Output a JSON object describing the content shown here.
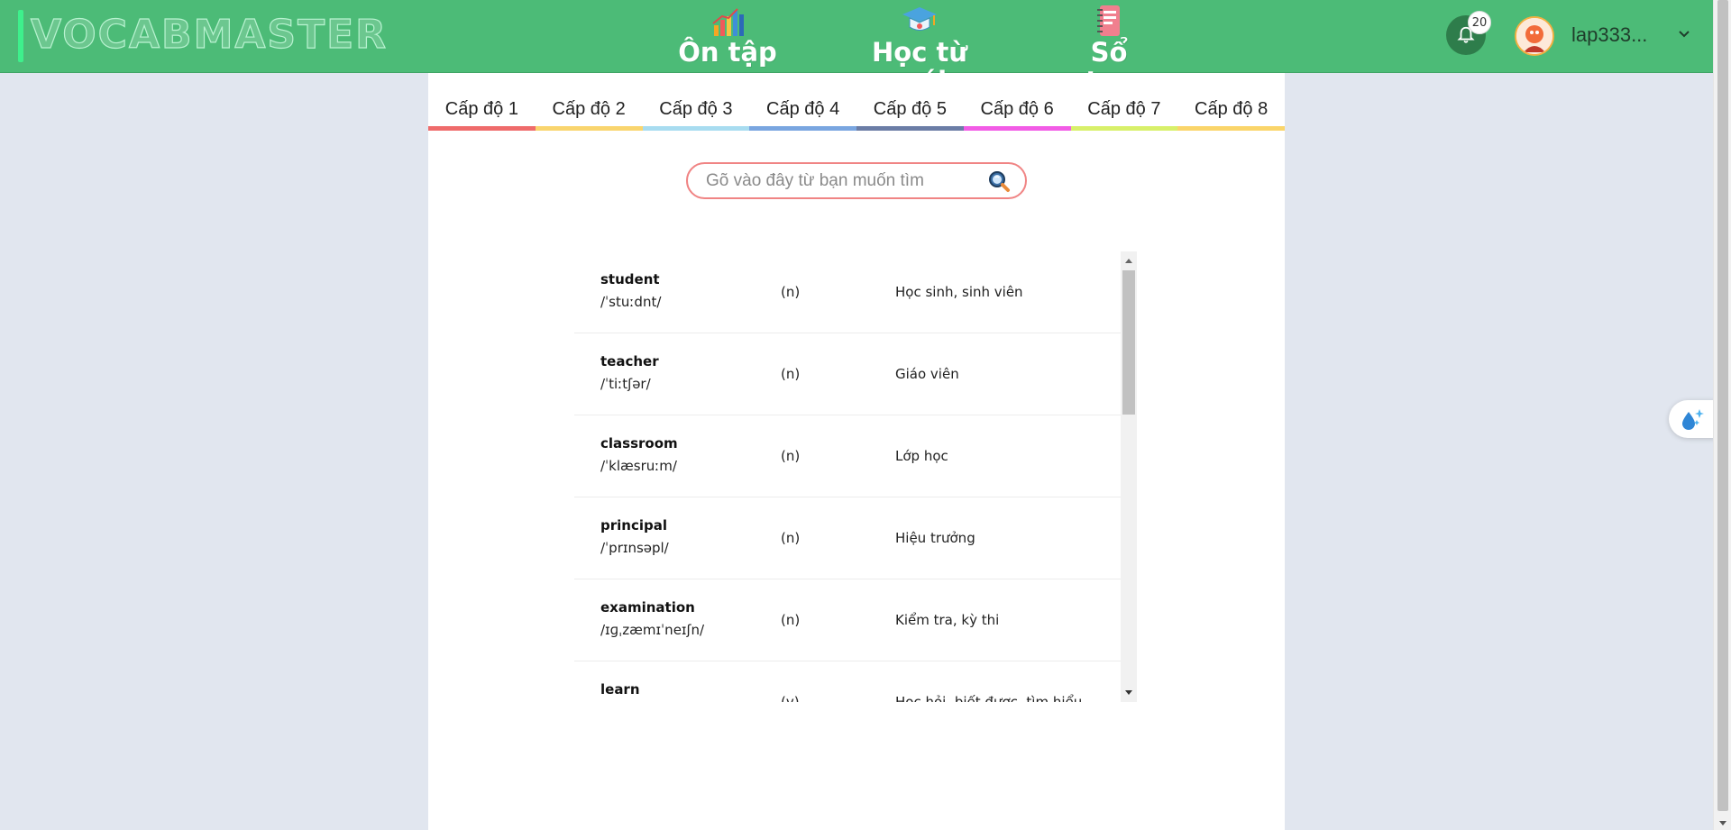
{
  "header": {
    "logo": "VOCABMASTER",
    "nav": [
      {
        "label": "Ôn tập",
        "icon": "bar-chart-icon"
      },
      {
        "label": "Học từ mới",
        "icon": "graduation-cap-icon"
      },
      {
        "label": "Sổ tay",
        "icon": "notebook-icon"
      }
    ],
    "notification_count": "20",
    "username": "lap333..."
  },
  "levels": [
    {
      "label": "Cấp độ 1",
      "color": "#ef6b6b"
    },
    {
      "label": "Cấp độ 2",
      "color": "#f9d56e"
    },
    {
      "label": "Cấp độ 3",
      "color": "#a8dcf0"
    },
    {
      "label": "Cấp độ 4",
      "color": "#7aa6e0"
    },
    {
      "label": "Cấp độ 5",
      "color": "#6b7da6"
    },
    {
      "label": "Cấp độ 6",
      "color": "#f25ce6"
    },
    {
      "label": "Cấp độ 7",
      "color": "#d8f06a"
    },
    {
      "label": "Cấp độ 8",
      "color": "#fad56a"
    }
  ],
  "search": {
    "placeholder": "Gõ vào đây từ bạn muốn tìm"
  },
  "words": [
    {
      "word": "student",
      "ipa": "/ˈstuːdnt/",
      "pos": "(n)",
      "meaning": "Học sinh, sinh viên"
    },
    {
      "word": "teacher",
      "ipa": "/ˈtiːtʃər/",
      "pos": "(n)",
      "meaning": "Giáo viên"
    },
    {
      "word": "classroom",
      "ipa": "/ˈklæsruːm/",
      "pos": "(n)",
      "meaning": "Lớp học"
    },
    {
      "word": "principal",
      "ipa": "/ˈprɪnsəpl/",
      "pos": "(n)",
      "meaning": "Hiệu trưởng"
    },
    {
      "word": "examination",
      "ipa": "/ɪɡˌzæmɪˈneɪʃn/",
      "pos": "(n)",
      "meaning": "Kiểm tra, kỳ thi"
    },
    {
      "word": "learn",
      "ipa": "",
      "pos": "(v)",
      "meaning": "Học hỏi, biết được, tìm hiểu"
    }
  ],
  "colors": {
    "header": "#4cbb77",
    "bell": "#2e7d4b",
    "search_border": "#f08484"
  }
}
